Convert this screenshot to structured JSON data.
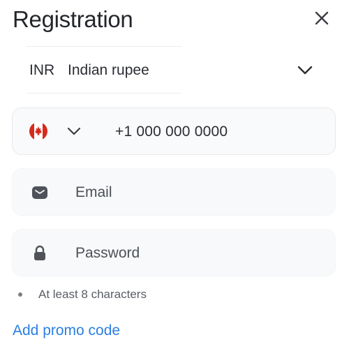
{
  "header": {
    "title": "Registration"
  },
  "icons": {
    "close": "close-icon",
    "chevron": "chevron-down-icon",
    "flag": "canada-flag-icon",
    "email": "envelope-icon",
    "password": "lock-icon"
  },
  "currency": {
    "code": "INR",
    "name": "Indian rupee"
  },
  "phone": {
    "value": "+1 000 000 0000"
  },
  "email": {
    "placeholder": "Email"
  },
  "password": {
    "placeholder": "Password"
  },
  "hint": {
    "text": "At least 8 characters"
  },
  "promo": {
    "label": "Add promo code"
  },
  "colors": {
    "link": "#2b7fe0",
    "text": "#23262b",
    "field_bg": "#f8f9fa",
    "icon": "#4f5258",
    "flag_red": "#d52b1e"
  }
}
